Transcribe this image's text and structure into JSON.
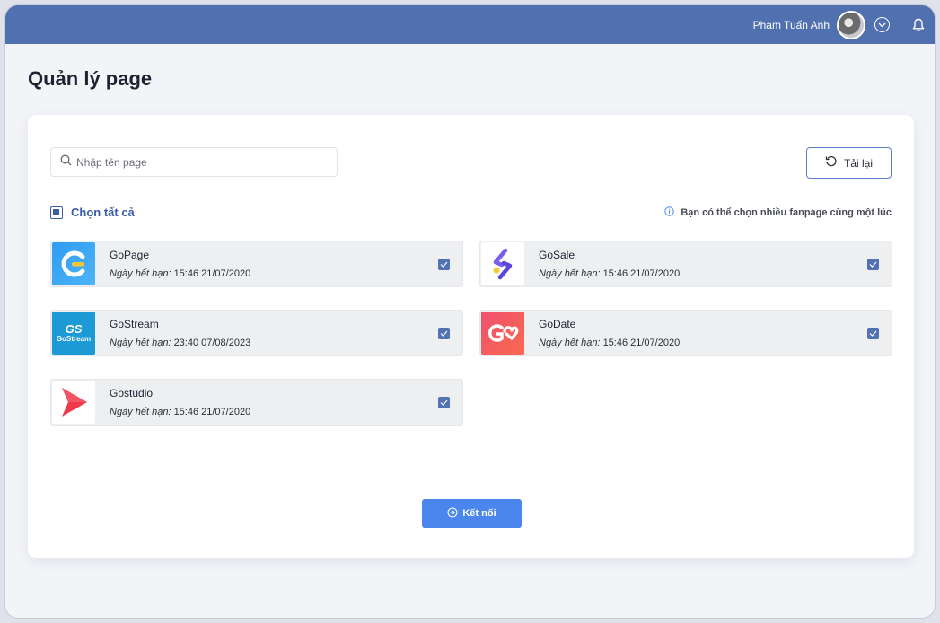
{
  "header": {
    "user_name": "Phạm Tuấn Anh"
  },
  "page_title": "Quản lý page",
  "search": {
    "placeholder": "Nhập tên page",
    "value": ""
  },
  "reload_label": "Tải lại",
  "select_all_label": "Chọn tất cả",
  "hint_text": "Bạn có thể chọn nhiều fanpage cùng một lúc",
  "expiry_prefix": "Ngày hết hạn:",
  "pages": [
    {
      "name": "GoPage",
      "expiry": "15:46 21/07/2020",
      "checked": true,
      "logo": "gopage-logo"
    },
    {
      "name": "GoSale",
      "expiry": "15:46 21/07/2020",
      "checked": true,
      "logo": "gosale-logo"
    },
    {
      "name": "GoStream",
      "expiry": "23:40 07/08/2023",
      "checked": true,
      "logo": "gostream-logo",
      "logo_text": "GS",
      "logo_subtext": "GoStream"
    },
    {
      "name": "GoDate",
      "expiry": "15:46 21/07/2020",
      "checked": true,
      "logo": "godate-logo"
    },
    {
      "name": "Gostudio",
      "expiry": "15:46 21/07/2020",
      "checked": true,
      "logo": "gostudio-logo"
    }
  ],
  "connect_label": "Kết nối",
  "colors": {
    "topbar": "#5170b0",
    "accent": "#3b5ca8",
    "button": "#4b86ef"
  }
}
